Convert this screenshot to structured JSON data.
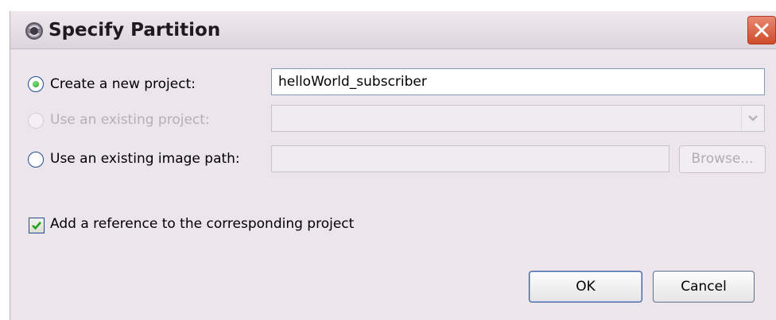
{
  "window": {
    "title": "Specify Partition",
    "icon": "eclipse-icon"
  },
  "options": {
    "create_new_project": {
      "label": "Create a new project:",
      "value": "helloWorld_subscriber",
      "selected": true
    },
    "use_existing_project": {
      "label": "Use an existing project:",
      "value": "",
      "enabled": false
    },
    "use_existing_image_path": {
      "label": "Use an existing image path:",
      "value": "",
      "browse_label": "Browse..."
    }
  },
  "add_reference": {
    "label": "Add a reference to the corresponding project",
    "checked": true
  },
  "buttons": {
    "ok": "OK",
    "cancel": "Cancel"
  },
  "colors": {
    "dialog_bg": "#ece5eb",
    "radio_selected": "#21a121",
    "close_button": "#cf4b2b"
  }
}
